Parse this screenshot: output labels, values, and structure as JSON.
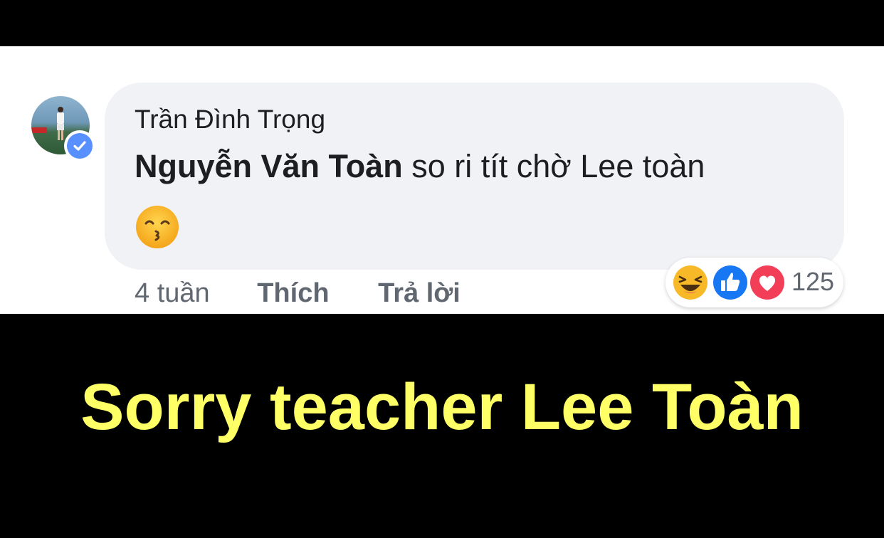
{
  "comment": {
    "author": "Trần Đình Trọng",
    "mention": "Nguyễn Văn Toàn",
    "text": " so ri tít chờ Lee toàn",
    "emoji": "kissing-face-with-smiling-eyes",
    "time": "4 tuần",
    "like_label": "Thích",
    "reply_label": "Trả lời",
    "reactions": [
      "laughing-face-icon",
      "like-icon",
      "love-icon"
    ],
    "reaction_count": "125",
    "verified": true
  },
  "caption": "Sorry teacher Lee Toàn",
  "colors": {
    "bubble": "#f0f2f5",
    "caption": "#ffff66",
    "like_blue": "#1877f2",
    "love_red": "#f33e58",
    "haha_yellow": "#f7b928"
  }
}
